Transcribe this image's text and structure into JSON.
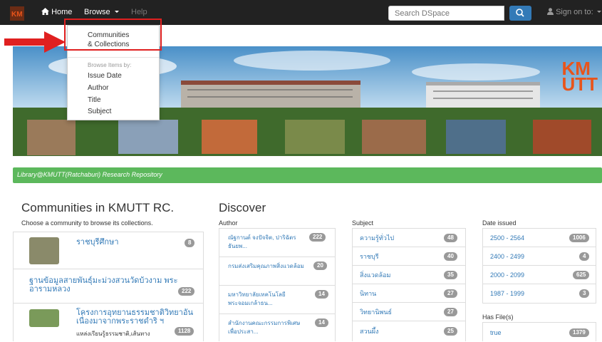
{
  "navbar": {
    "home_label": "Home",
    "browse_label": "Browse",
    "help_label": "Help",
    "search_placeholder": "Search DSpace",
    "sign_in_label": "Sign on to:",
    "logo_text": "KM"
  },
  "browse_menu": {
    "communities_line1": "Communities",
    "communities_line2": "& Collections",
    "browse_header": "Browse Items by:",
    "items": [
      "Issue Date",
      "Author",
      "Title",
      "Subject"
    ]
  },
  "banner": {
    "logo_line1": "KM",
    "logo_line2": "UTT"
  },
  "repository_title": "Library@KMUTT(Ratchaburi) Research Repository",
  "communities": {
    "heading": "Communities in KMUTT RC.",
    "subheading": "Choose a community to browse its collections.",
    "items": [
      {
        "name": "ราชบุรีศึกษา",
        "count": "8"
      },
      {
        "name": "ฐานข้อมูลสายพันธุ์มะม่วงสวนวัดบ้วงาม พระอารามหลวง",
        "count": "222"
      },
      {
        "name": "โครงการอุทยานธรรมชาติวิทยาอันเนื่องมาจากพระราชดำริ ฯ",
        "desc": "แหล่งเรียนรู้ธรรมชาติ,เส้นทาง",
        "count": "1128"
      }
    ]
  },
  "discover": {
    "heading": "Discover",
    "author": {
      "label": "Author",
      "items": [
        {
          "name": "ณัฐกานต์ จงปัจจิต, ปาริฉัตร ธันยพ...",
          "count": "222"
        },
        {
          "name": "กรมส่งเสริมคุณภาพสิ่งแวดล้อม",
          "count": "20"
        },
        {
          "name": "มหาวิทยาลัยเทคโนโลยีพระจอมเกล้าธน...",
          "count": "14"
        },
        {
          "name": "สำนักงานคณะกรรมการพิเศษเพื่อประสา...",
          "count": "14"
        }
      ]
    },
    "subject": {
      "label": "Subject",
      "items": [
        {
          "name": "ความรู้ทั่วไป",
          "count": "48"
        },
        {
          "name": "ราชบุรี",
          "count": "40"
        },
        {
          "name": "สิ่งแวดล้อม",
          "count": "35"
        },
        {
          "name": "นิทาน",
          "count": "27"
        },
        {
          "name": "วิทยานิพนธ์",
          "count": "27"
        },
        {
          "name": "สวนผึ้ง",
          "count": "25"
        }
      ]
    },
    "date_issued": {
      "label": "Date issued",
      "items": [
        {
          "name": "2500 - 2564",
          "count": "1006"
        },
        {
          "name": "2400 - 2499",
          "count": "4"
        },
        {
          "name": "2000 - 2099",
          "count": "625"
        },
        {
          "name": "1987 - 1999",
          "count": "3"
        }
      ]
    },
    "has_files": {
      "label": "Has File(s)",
      "items": [
        {
          "name": "true",
          "count": "1379"
        }
      ]
    }
  },
  "colors": {
    "navbar": "#222222",
    "link": "#337ab7",
    "repo_bar": "#5cb85c",
    "badge": "#999999",
    "highlight": "#e02020"
  }
}
